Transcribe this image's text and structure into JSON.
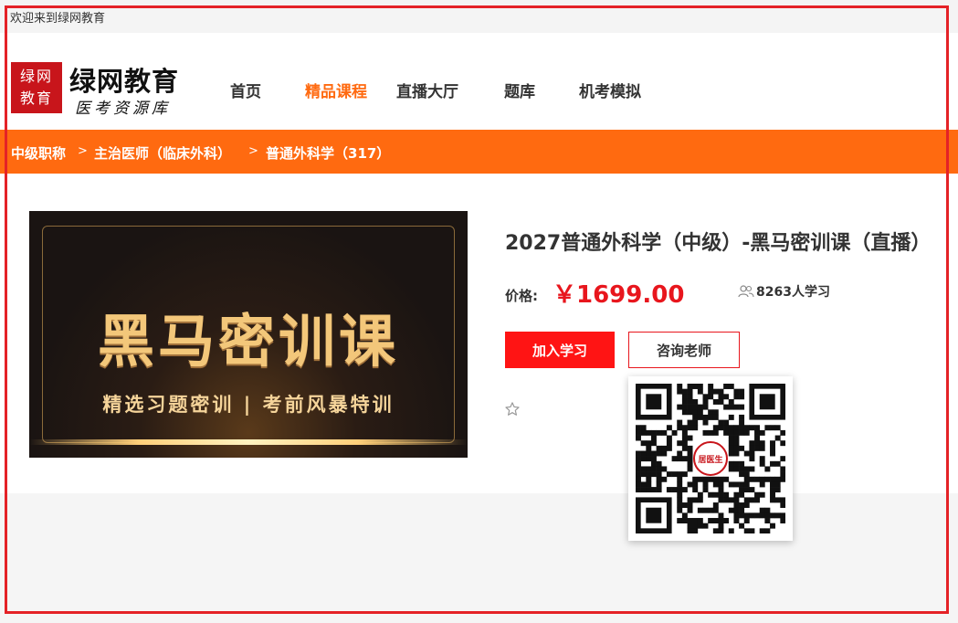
{
  "topbar": {
    "welcome": "欢迎来到绿网教育"
  },
  "logo": {
    "seal_line1": "绿网",
    "seal_line2": "教育",
    "title": "绿网教育",
    "subtitle": "医考资源库",
    "seal_color": "#c8151b"
  },
  "nav": {
    "items": [
      {
        "label": "首页"
      },
      {
        "label": "精品课程"
      },
      {
        "label": "直播大厅"
      },
      {
        "label": "题库"
      },
      {
        "label": "机考模拟"
      }
    ],
    "active_color": "#ff6a10"
  },
  "breadcrumb": {
    "items": [
      {
        "label": "中级职称"
      },
      {
        "label": "主治医师（临床外科）"
      },
      {
        "label": "普通外科学（317）"
      }
    ],
    "separator": ">",
    "bar_color": "#ff6a10"
  },
  "banner": {
    "title": "黑马密训课",
    "subtitle": "精选习题密训 | 考前风暴特训"
  },
  "course": {
    "title": "2027普通外科学（中级）-黑马密训课（直播）",
    "price_label": "价格:",
    "price": "￥1699.00",
    "learners": "8263人学习",
    "join_button": "加入学习",
    "consult_button": "咨询老师",
    "price_color": "#e8161d"
  },
  "qr": {
    "center_label": "居医生"
  },
  "icons": {
    "learners": "users-icon",
    "favorite": "star-outline-icon",
    "qr": "qr-code-icon"
  }
}
